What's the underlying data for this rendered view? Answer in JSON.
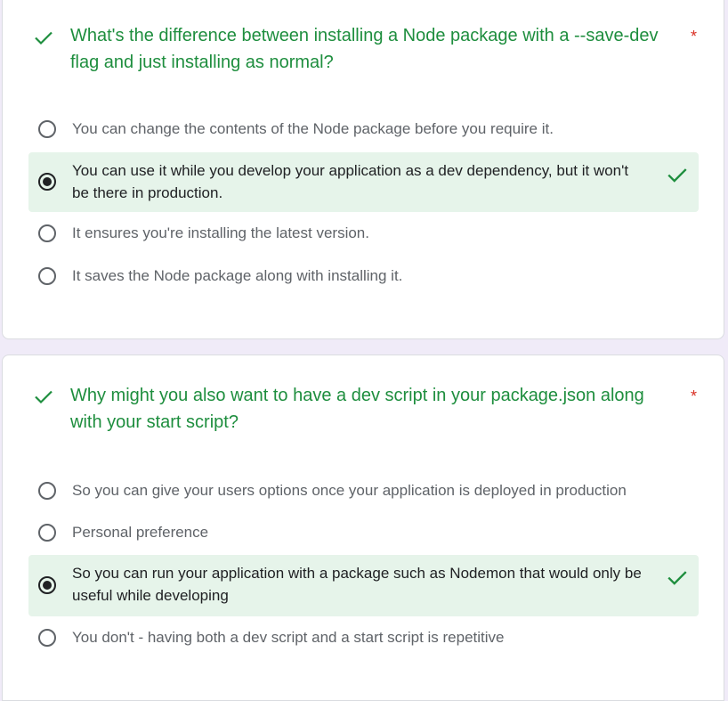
{
  "questions": [
    {
      "text": "What's the difference between installing a Node package with a --save-dev flag and just installing as normal?",
      "required_mark": "*",
      "options": [
        "You can change the contents of the Node package before you require it.",
        "You can use it while you develop your application as a dev dependency, but it won't be there in production.",
        "It ensures you're installing the latest version.",
        "It saves the Node package along with installing it."
      ],
      "selected_index": 1,
      "correct_index": 1
    },
    {
      "text": "Why might you also want to have a dev script in your package.json along with your start script?",
      "required_mark": "*",
      "options": [
        "So you can give your users options once your application is deployed in production",
        "Personal preference",
        "So you can run your application with a package such as Nodemon that would only be useful while developing",
        "You don't - having both a dev script and a start script is repetitive"
      ],
      "selected_index": 2,
      "correct_index": 2
    }
  ],
  "icons": {
    "correct": "check-icon",
    "radio_on": "radio-checked-icon",
    "radio_off": "radio-unchecked-icon"
  },
  "colors": {
    "correct_text": "#1e8e3e",
    "correct_bg": "#e6f4ea",
    "required": "#d93025",
    "page_bg": "#f0ebf8"
  }
}
